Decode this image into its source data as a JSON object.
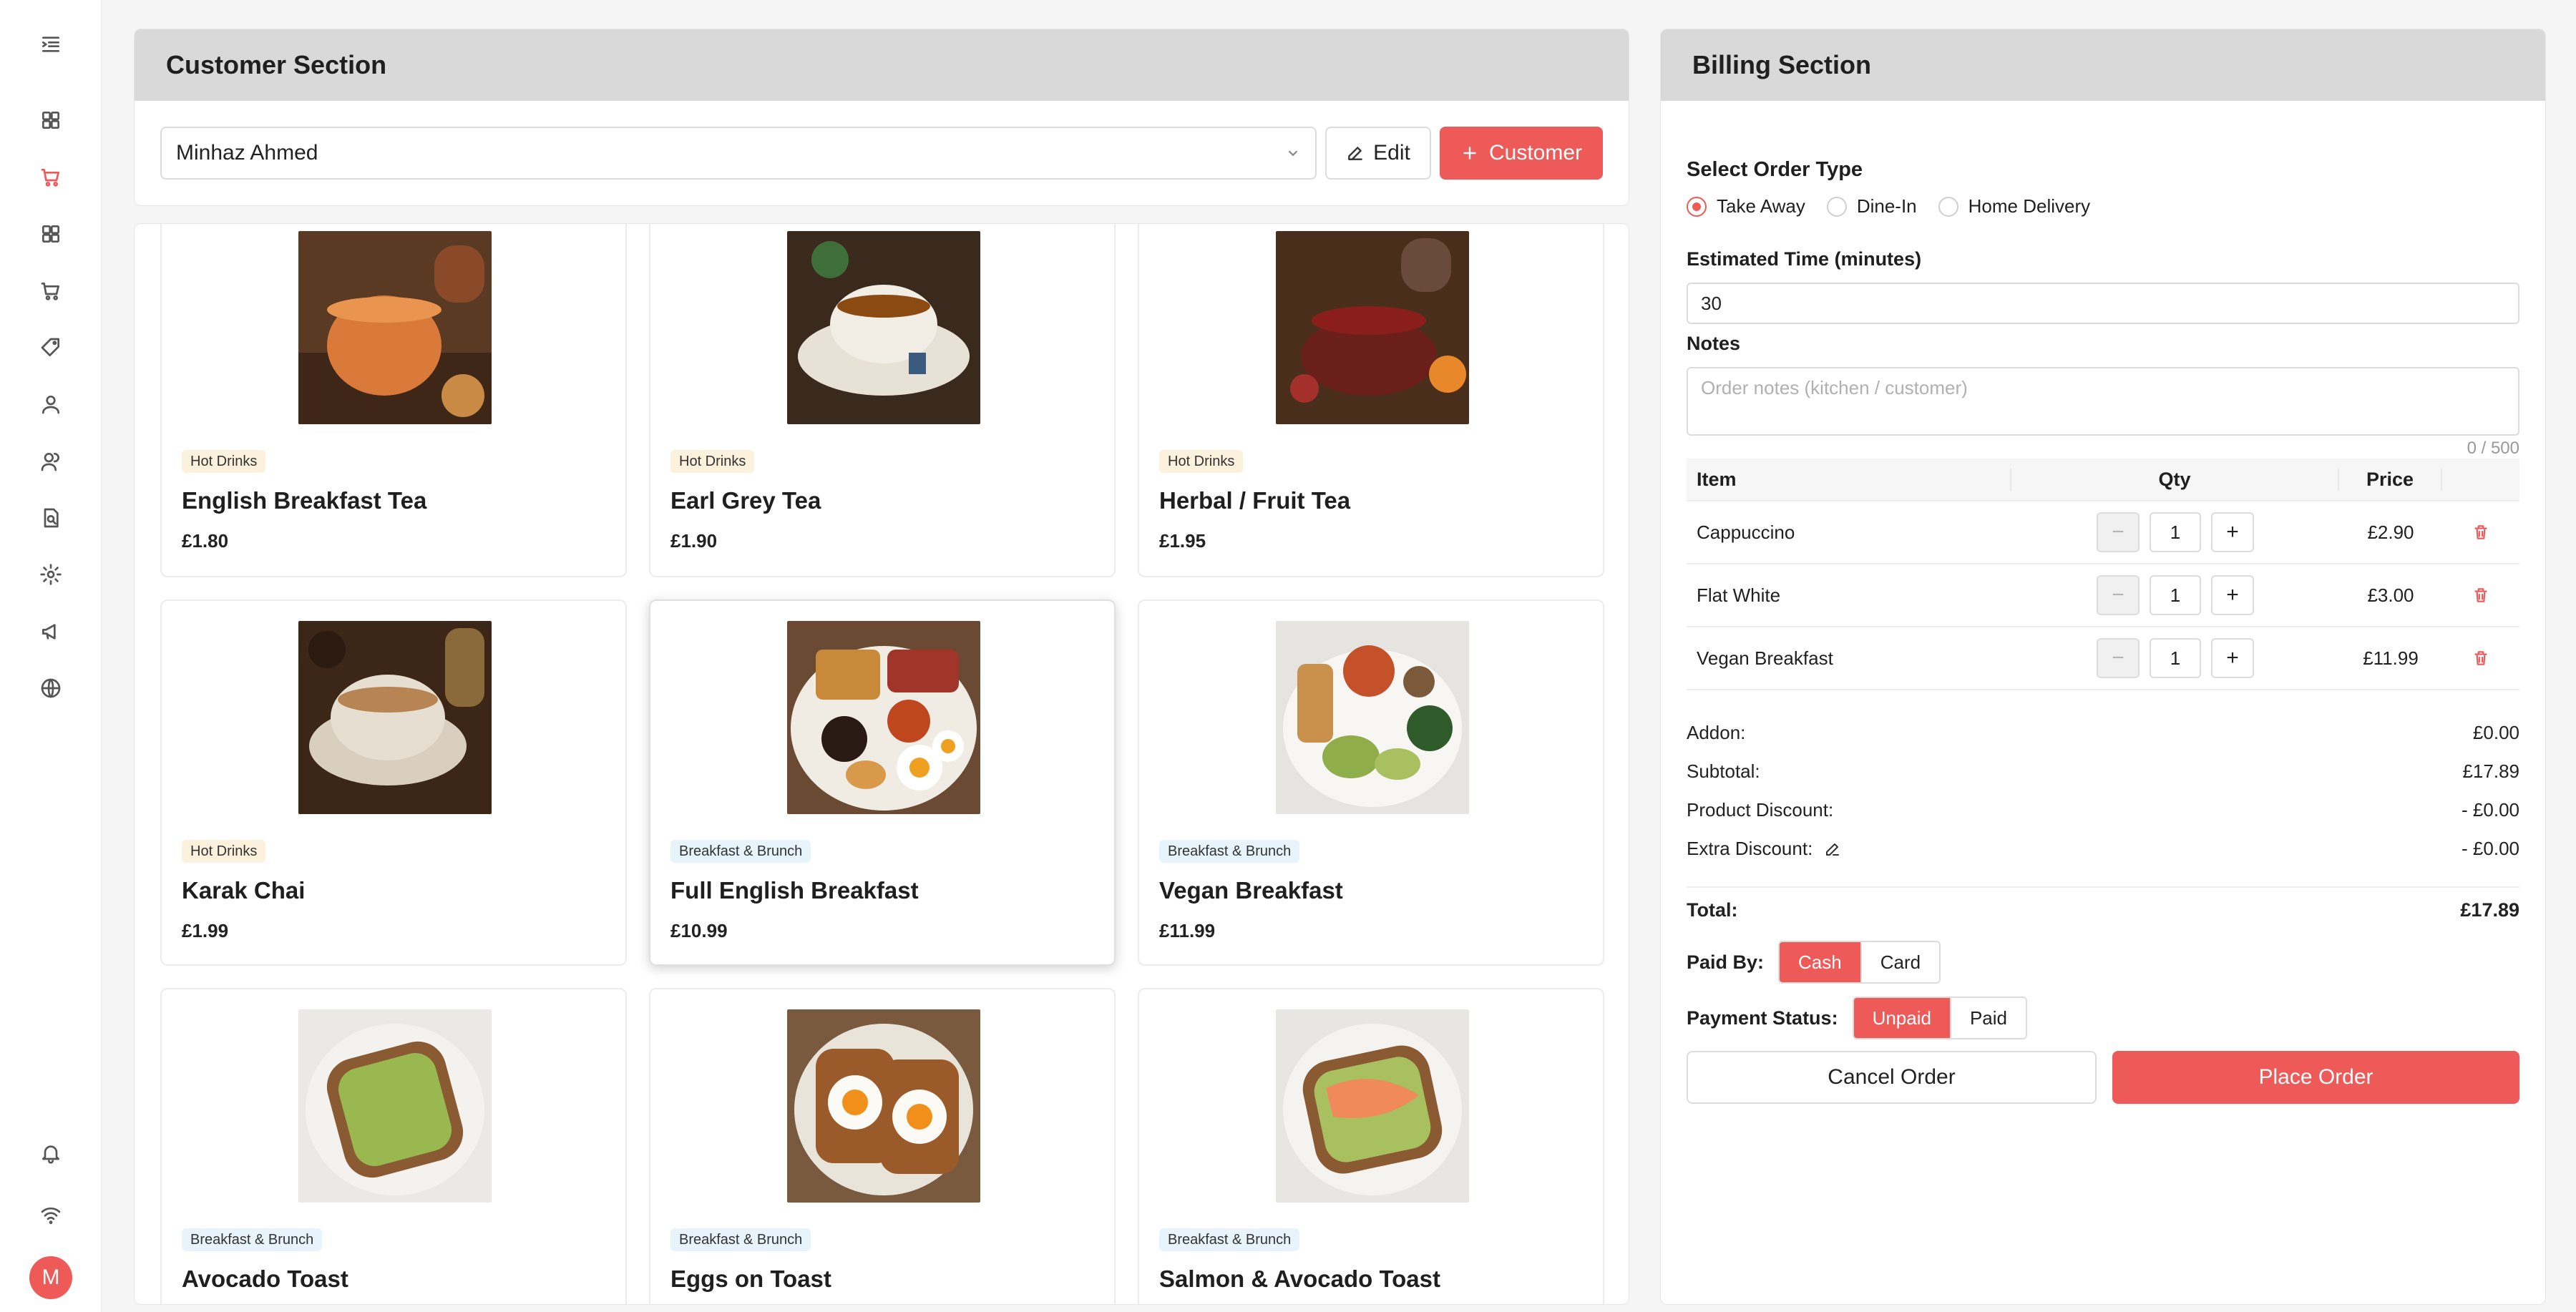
{
  "colors": {
    "accent": "#ee5a57",
    "panel_header": "#d9d9d9",
    "hot_badge": "#fbf1dc",
    "brunch_badge": "#e8f4fb"
  },
  "sidebar": {
    "items": [
      {
        "icon": "menu-collapse-icon"
      },
      {
        "icon": "dashboard-icon"
      },
      {
        "icon": "cart-icon",
        "active": true
      },
      {
        "icon": "grid-icon"
      },
      {
        "icon": "cart-icon"
      },
      {
        "icon": "tag-icon"
      },
      {
        "icon": "user-icon"
      },
      {
        "icon": "users-icon"
      },
      {
        "icon": "report-icon"
      },
      {
        "icon": "gear-icon"
      },
      {
        "icon": "megaphone-icon"
      },
      {
        "icon": "globe-icon"
      },
      {
        "icon": "bell-icon"
      },
      {
        "icon": "wifi-icon"
      }
    ],
    "avatar_letter": "M"
  },
  "customer": {
    "title": "Customer Section",
    "selected_customer": "Minhaz Ahmed",
    "edit_label": "Edit",
    "add_label": "Customer"
  },
  "products": [
    {
      "category": "Hot Drinks",
      "name": "English Breakfast Tea",
      "price": "£1.80"
    },
    {
      "category": "Hot Drinks",
      "name": "Earl Grey Tea",
      "price": "£1.90"
    },
    {
      "category": "Hot Drinks",
      "name": "Herbal / Fruit Tea",
      "price": "£1.95"
    },
    {
      "category": "Hot Drinks",
      "name": "Karak Chai",
      "price": "£1.99"
    },
    {
      "category": "Breakfast & Brunch",
      "name": "Full English Breakfast",
      "price": "£10.99"
    },
    {
      "category": "Breakfast & Brunch",
      "name": "Vegan Breakfast",
      "price": "£11.99"
    },
    {
      "category": "Breakfast & Brunch",
      "name": "Avocado Toast",
      "price": ""
    },
    {
      "category": "Breakfast & Brunch",
      "name": "Eggs on Toast",
      "price": ""
    },
    {
      "category": "Breakfast & Brunch",
      "name": "Salmon & Avocado Toast",
      "price": ""
    }
  ],
  "billing": {
    "title": "Billing Section",
    "order_type_label": "Select Order Type",
    "order_types": [
      "Take Away",
      "Dine-In",
      "Home Delivery"
    ],
    "selected_order_type": "Take Away",
    "est_time_label": "Estimated Time (minutes)",
    "est_time_value": "30",
    "notes_label": "Notes",
    "notes_placeholder": "Order notes (kitchen / customer)",
    "notes_counter": "0 / 500",
    "table_headers": {
      "item": "Item",
      "qty": "Qty",
      "price": "Price"
    },
    "items": [
      {
        "name": "Cappuccino",
        "qty": "1",
        "price": "£2.90"
      },
      {
        "name": "Flat White",
        "qty": "1",
        "price": "£3.00"
      },
      {
        "name": "Vegan Breakfast",
        "qty": "1",
        "price": "£11.99"
      }
    ],
    "summary": {
      "addon_label": "Addon:",
      "addon_value": "£0.00",
      "subtotal_label": "Subtotal:",
      "subtotal_value": "£17.89",
      "product_discount_label": "Product Discount:",
      "product_discount_value": "- £0.00",
      "extra_discount_label": "Extra Discount:",
      "extra_discount_value": "- £0.00",
      "total_label": "Total:",
      "total_value": "£17.89"
    },
    "paid_by_label": "Paid By:",
    "paid_by_options": [
      "Cash",
      "Card"
    ],
    "paid_by_selected": "Cash",
    "payment_status_label": "Payment Status:",
    "payment_status_options": [
      "Unpaid",
      "Paid"
    ],
    "payment_status_selected": "Unpaid",
    "cancel_label": "Cancel Order",
    "place_label": "Place Order"
  }
}
